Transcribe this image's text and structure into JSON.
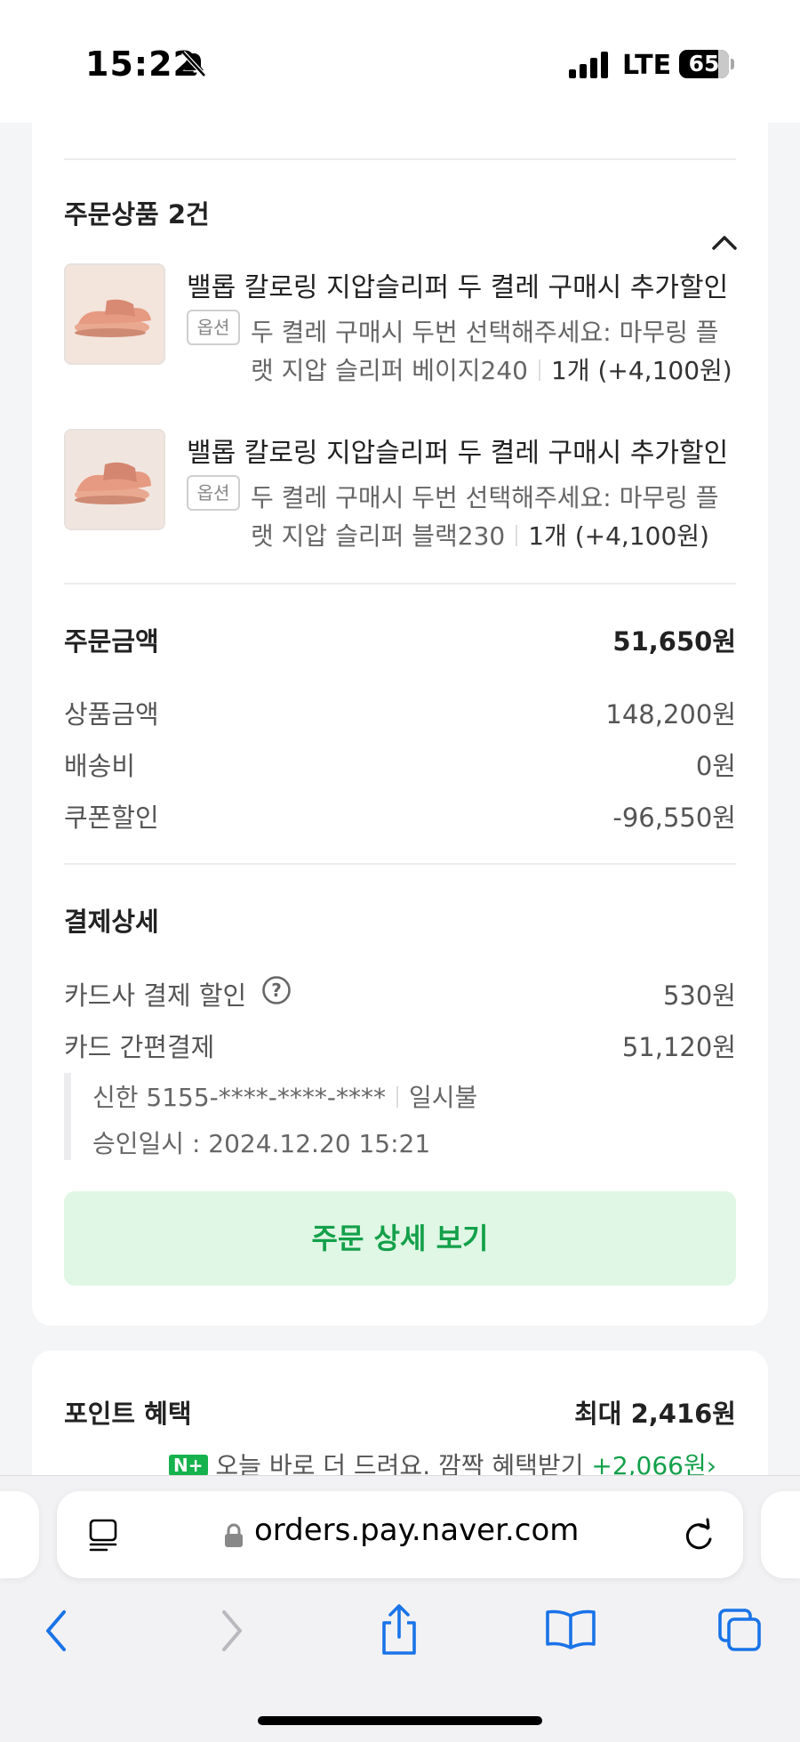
{
  "status_bar": {
    "time": "15:22",
    "network": "LTE",
    "battery": "65"
  },
  "order_items": {
    "heading": "주문상품 2건",
    "collapse_icon": "chevron-up-icon",
    "items": [
      {
        "name": "밸롭 칼로링 지압슬리퍼 두 켤레 구매시 추가할인",
        "option_badge": "옵션",
        "option_line1": "두 켤레 구매시 두번 선택해주세요: 마무링 플",
        "option_line2": "랫 지압 슬리퍼 베이지240",
        "qty": "1개 (+4,100원)"
      },
      {
        "name": "밸롭 칼로링 지압슬리퍼 두 켤레 구매시 추가할인",
        "option_badge": "옵션",
        "option_line1": "두 켤레 구매시 두번 선택해주세요: 마무링 플",
        "option_line2": "랫 지압 슬리퍼 블랙230",
        "qty": "1개 (+4,100원)"
      }
    ]
  },
  "order_amount": {
    "label": "주문금액",
    "total": "51,650원",
    "rows": [
      {
        "label": "상품금액",
        "value": "148,200원"
      },
      {
        "label": "배송비",
        "value": "0원"
      },
      {
        "label": "쿠폰할인",
        "value": "-96,550원"
      }
    ]
  },
  "payment_detail": {
    "label": "결제상세",
    "card_discount_label": "카드사 결제 할인",
    "card_discount_value": "530원",
    "easy_pay_label": "카드 간편결제",
    "easy_pay_value": "51,120원",
    "card_info": "신한 5155-****-****-****",
    "installment": "일시불",
    "approval": "승인일시 : 2024.12.20 15:21"
  },
  "detail_button": "주문 상세 보기",
  "points": {
    "label": "포인트 혜택",
    "max": "최대 2,416원",
    "promo_badge": "N+",
    "promo_text": "오늘 바로 더 드려요. 깜짝 혜택받기",
    "promo_amount": "+2,066원"
  },
  "browser": {
    "url": "orders.pay.naver.com"
  },
  "colors": {
    "accent_green": "#13a04a",
    "button_bg": "#dff7e4",
    "page_bg": "#f4f5f7"
  }
}
